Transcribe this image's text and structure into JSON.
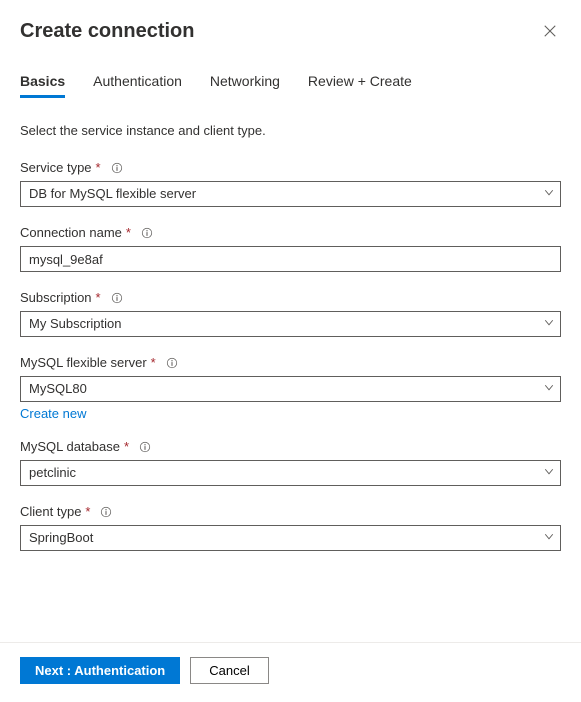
{
  "dialog": {
    "title": "Create connection"
  },
  "tabs": {
    "basics": "Basics",
    "authentication": "Authentication",
    "networking": "Networking",
    "review": "Review + Create"
  },
  "intro": "Select the service instance and client type.",
  "fields": {
    "serviceType": {
      "label": "Service type",
      "value": "DB for MySQL flexible server"
    },
    "connectionName": {
      "label": "Connection name",
      "value": "mysql_9e8af"
    },
    "subscription": {
      "label": "Subscription",
      "value": "My Subscription"
    },
    "server": {
      "label": "MySQL flexible server",
      "value": "MySQL80",
      "createNew": "Create new"
    },
    "database": {
      "label": "MySQL database",
      "value": "petclinic"
    },
    "clientType": {
      "label": "Client type",
      "value": "SpringBoot"
    }
  },
  "footer": {
    "next": "Next : Authentication",
    "cancel": "Cancel"
  },
  "symbols": {
    "required": "*"
  }
}
